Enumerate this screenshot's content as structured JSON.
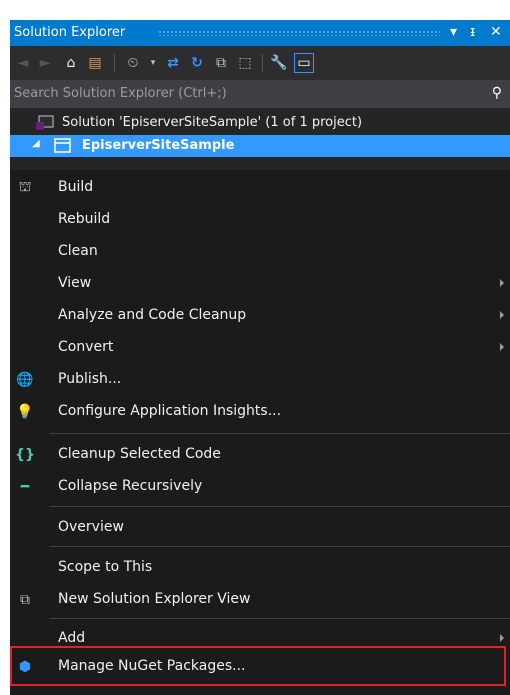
{
  "panel": {
    "title": "Solution Explorer",
    "dropdown_glyph": "▾",
    "pin_glyph": "ᵻ",
    "close_glyph": "✕"
  },
  "toolbar": {
    "back_glyph": "◄",
    "forward_glyph": "►",
    "home_glyph": "⌂",
    "history_glyph": "⏲",
    "sync_glyph": "⇄",
    "refresh_glyph": "↻",
    "collapse_glyph": "⧉",
    "files_glyph": "⬚",
    "properties_glyph": "🔧",
    "preview_glyph": "▭"
  },
  "search": {
    "placeholder": "Search Solution Explorer (Ctrl+;)",
    "icon_glyph": "⚲"
  },
  "tree": {
    "solution_label": "Solution 'EpiserverSiteSample' (1 of 1 project)",
    "project_label": "EpiserverSiteSample",
    "expand_glyph": "◢"
  },
  "menu": {
    "items": [
      {
        "label": "Build",
        "icon": "build-icon",
        "glyph": "⛫"
      },
      {
        "label": "Rebuild"
      },
      {
        "label": "Clean"
      },
      {
        "label": "View",
        "submenu": true
      },
      {
        "label": "Analyze and Code Cleanup",
        "submenu": true
      },
      {
        "label": "Convert",
        "submenu": true
      },
      {
        "label": "Publish...",
        "icon": "publish-globe-icon",
        "glyph": "🌐"
      },
      {
        "label": "Configure Application Insights...",
        "icon": "application-insights-icon",
        "glyph": "💡"
      },
      {
        "label": "Cleanup Selected Code",
        "icon": "braces-icon",
        "glyph": "{}"
      },
      {
        "label": "Collapse Recursively",
        "icon": "collapse-icon",
        "glyph": "━"
      },
      {
        "label": "Overview"
      },
      {
        "label": "Scope to This"
      },
      {
        "label": "New Solution Explorer View",
        "icon": "new-view-icon",
        "glyph": "⧉"
      },
      {
        "label": "Add",
        "submenu": true
      },
      {
        "label": "Manage NuGet Packages...",
        "icon": "nuget-icon",
        "glyph": "⬢"
      }
    ]
  },
  "colors": {
    "accent": "#007acc",
    "selection": "#3399ff",
    "highlight_border": "#e0222c",
    "menu_bg": "#1b1b1c"
  }
}
